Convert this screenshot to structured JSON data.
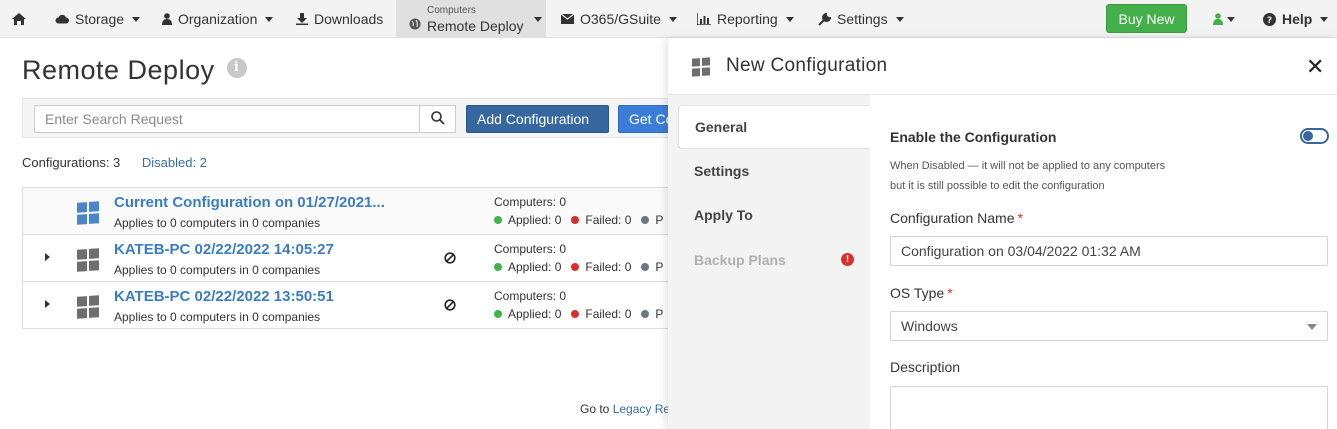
{
  "nav": {
    "items": [
      {
        "label": "Storage",
        "icon": "cloud-icon"
      },
      {
        "label": "Organization",
        "icon": "user-icon"
      },
      {
        "label": "Downloads",
        "icon": "download-icon"
      },
      {
        "label": "Remote Deploy",
        "small_label": "Computers",
        "icon": "globe-icon",
        "active": true
      },
      {
        "label": "O365/GSuite",
        "icon": "envelope-icon"
      },
      {
        "label": "Reporting",
        "icon": "bar-chart-icon"
      },
      {
        "label": "Settings",
        "icon": "wrench-icon"
      }
    ],
    "buy_new": "Buy New",
    "help": "Help"
  },
  "page": {
    "title": "Remote Deploy",
    "search_placeholder": "Enter Search Request",
    "add_configuration": "Add Configuration",
    "get_config": "Get Co",
    "configurations_label": "Configurations: 3",
    "disabled_label": "Disabled: 2",
    "legacy_prefix": "Go to",
    "legacy_link": "Legacy Re"
  },
  "rows": [
    {
      "title": "Current Configuration on 01/27/2021...",
      "sub": "Applies to 0 computers in 0 companies",
      "computers": "Computers: 0",
      "applied": "Applied: 0",
      "failed": "Failed: 0",
      "pending": "P"
    },
    {
      "title": "KATEB-PC 02/22/2022 14:05:27",
      "sub": "Applies to 0 computers in 0 companies",
      "computers": "Computers: 0",
      "applied": "Applied: 0",
      "failed": "Failed: 0",
      "pending": "P"
    },
    {
      "title": "KATEB-PC 02/22/2022 13:50:51",
      "sub": "Applies to 0 computers in 0 companies",
      "computers": "Computers: 0",
      "applied": "Applied: 0",
      "failed": "Failed: 0",
      "pending": "P"
    }
  ],
  "panel": {
    "title": "New Configuration",
    "tabs": [
      "General",
      "Settings",
      "Apply To",
      "Backup Plans"
    ],
    "enable_label": "Enable the Configuration",
    "help_line1": "When Disabled — it will not be applied to any computers",
    "help_line2": "but it is still possible to edit the configuration",
    "name_label": "Configuration Name",
    "name_value": "Configuration on 03/04/2022 01:32 AM",
    "os_label": "OS Type",
    "os_value": "Windows",
    "required_mark": "*",
    "description_label": "Description"
  },
  "colors": {
    "accent": "#37679f",
    "link": "#3a7dc4",
    "buy": "#43b04a",
    "applied": "#3cb54a",
    "failed": "#d9302e",
    "pending": "#6b7785"
  }
}
